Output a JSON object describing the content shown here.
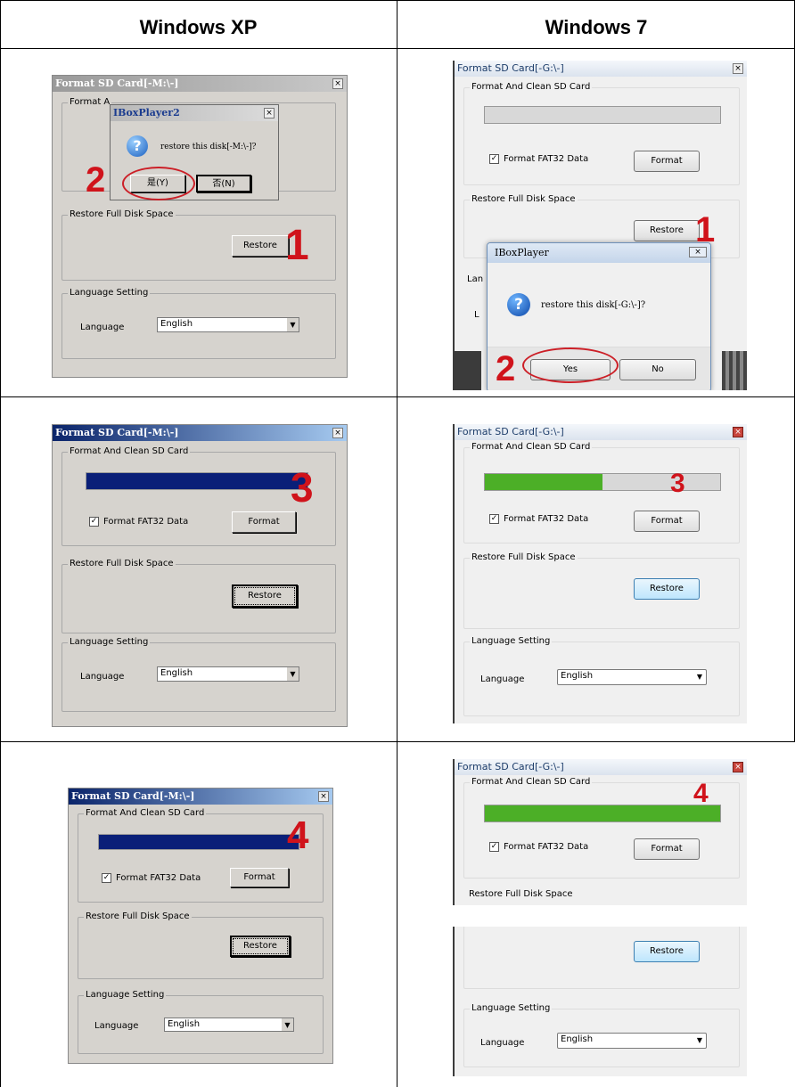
{
  "headers": {
    "xp": "Windows XP",
    "w7": "Windows 7"
  },
  "titles": {
    "xp": "Format SD Card[-M:\\-]",
    "w7": "Format SD Card[-G:\\-]"
  },
  "labels": {
    "format_group": "Format And Clean SD Card",
    "fat32": "Format FAT32 Data",
    "format_btn": "Format",
    "restore_group": "Restore Full Disk Space",
    "restore_btn": "Restore",
    "lang_group": "Language Setting",
    "lang_label": "Language",
    "lang_value": "English",
    "lang_cut": "Lan",
    "lang_cut2": "L",
    "close": "×"
  },
  "xp_popup": {
    "title": "IBoxPlayer2",
    "message": "restore this disk[-M:\\-]?",
    "yes": "是(Y)",
    "no": "否(N)",
    "close": "×",
    "partial_group": "Format A",
    "partial_tail": "-- 1"
  },
  "w7_popup": {
    "title": "IBoxPlayer",
    "message": "restore this disk[-G:\\-]?",
    "yes": "Yes",
    "no": "No",
    "close": "×"
  },
  "steps": {
    "s1": "1",
    "s2": "2",
    "s3": "3",
    "s4": "4"
  },
  "progress": {
    "xp_row2": 1.0,
    "w7_row2": 0.5,
    "xp_row3": 1.0,
    "w7_row3": 1.0
  },
  "colors": {
    "xp_fill": "#0a1f78",
    "w7_fill": "#4caf27",
    "accent": "#d0131b"
  }
}
